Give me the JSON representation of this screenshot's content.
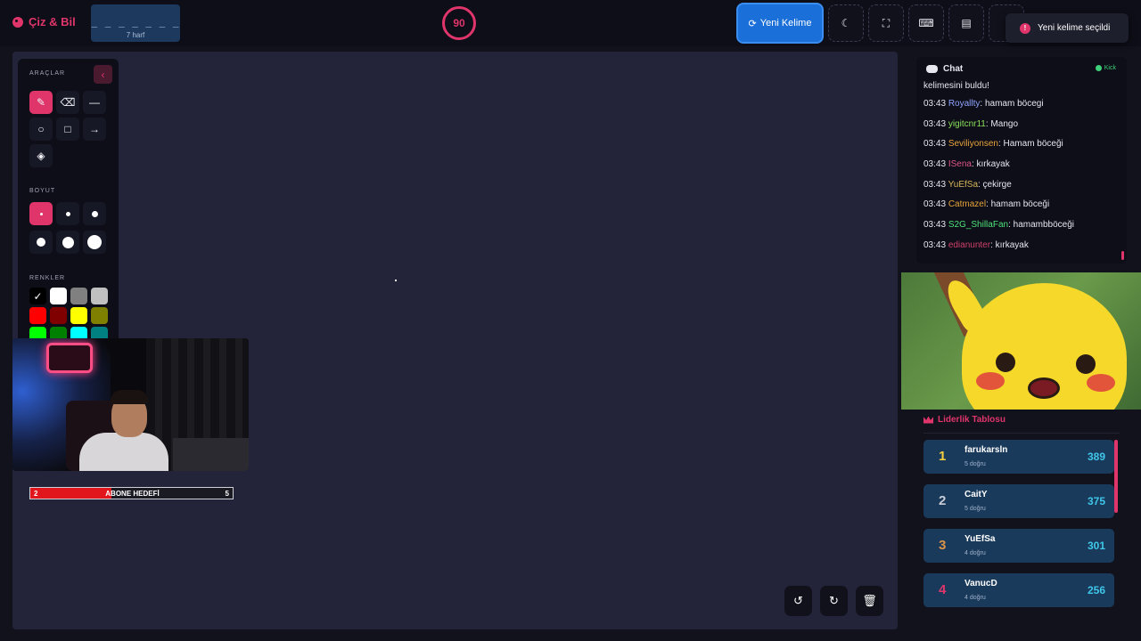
{
  "header": {
    "app_title": "Çiz & Bil",
    "word_mask": "_ _ _ _ _ _ _",
    "word_length": "7 harf",
    "timer": "90",
    "new_word_label": "Yeni Kelime",
    "toast": "Yeni kelime seçildi",
    "icons": [
      "palette-icon",
      "refresh-icon",
      "moon-icon",
      "fullscreen-icon",
      "keyboard-icon",
      "archive-icon",
      "info-icon",
      "info-circle-icon"
    ]
  },
  "tools": {
    "section_tools": "ARAÇLAR",
    "section_size": "BOYUT",
    "section_colors": "RENKLER",
    "tool_icons": [
      "brush-icon",
      "eraser-icon",
      "line-icon",
      "circle-icon",
      "square-icon",
      "arrow-icon",
      "fill-icon"
    ],
    "active_tool": "brush-icon",
    "active_size": 0,
    "colors": [
      "#000000",
      "#ffffff",
      "#808080",
      "#c0c0c0",
      "#ff0000",
      "#800000",
      "#ffff00",
      "#808000",
      "#00ff00",
      "#008000",
      "#00ffff",
      "#008080"
    ],
    "active_color": "#000000"
  },
  "goal": {
    "current": "2",
    "title": "ABONE HEDEFİ",
    "target": "5",
    "progress": 0.4
  },
  "canvas_buttons": [
    "undo-icon",
    "redo-icon",
    "trash-icon"
  ],
  "chat": {
    "title": "Chat",
    "platform": "Kick",
    "first_line": "kelimesini buldu!",
    "messages": [
      {
        "time": "03:43",
        "user": "Royallty",
        "color": "#8fa3ff",
        "text": ": hamam böcegi"
      },
      {
        "time": "03:43",
        "user": "yigitcnr11",
        "color": "#8be05a",
        "text": ": Mango"
      },
      {
        "time": "03:43",
        "user": "Seviliyonsen",
        "color": "#e8a43c",
        "text": ": Hamam böceği"
      },
      {
        "time": "03:43",
        "user": "ISena",
        "color": "#e0558a",
        "text": ": kırkayak"
      },
      {
        "time": "03:43",
        "user": "YuEfSa",
        "color": "#d8b85a",
        "text": ": çekirge"
      },
      {
        "time": "03:43",
        "user": "Catmazel",
        "color": "#e8a43c",
        "text": ": hamam böceği"
      },
      {
        "time": "03:43",
        "user": "S2G_ShillaFan",
        "color": "#4fe07a",
        "text": ": hamambböceği"
      },
      {
        "time": "03:43",
        "user": "edianunter",
        "color": "#d0406a",
        "text": ": kırkayak"
      }
    ]
  },
  "leaderboard": {
    "title": "Liderlik Tablosu",
    "rows": [
      {
        "rank": "1",
        "rank_color": "#f4d03f",
        "name": "farukarsln",
        "sub": "5 doğru",
        "score": "389"
      },
      {
        "rank": "2",
        "rank_color": "#c8ccd6",
        "name": "CaitY",
        "sub": "5 doğru",
        "score": "375"
      },
      {
        "rank": "3",
        "rank_color": "#d9934a",
        "name": "YuEfSa",
        "sub": "4 doğru",
        "score": "301"
      },
      {
        "rank": "4",
        "rank_color": "#e0356b",
        "name": "VanucD",
        "sub": "4 doğru",
        "score": "256"
      }
    ]
  }
}
